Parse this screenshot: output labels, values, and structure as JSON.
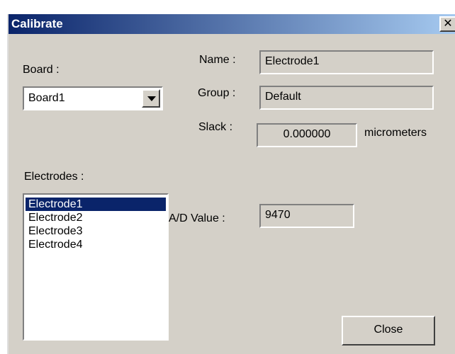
{
  "window": {
    "title": "Calibrate",
    "close_glyph": "✕"
  },
  "board": {
    "label": "Board :",
    "selected": "Board1"
  },
  "name": {
    "label": "Name :",
    "value": "Electrode1"
  },
  "group": {
    "label": "Group :",
    "value": "Default"
  },
  "slack": {
    "label": "Slack :",
    "value": "0.000000",
    "unit": "micrometers"
  },
  "electrodes": {
    "label": "Electrodes :",
    "items": [
      "Electrode1",
      "Electrode2",
      "Electrode3",
      "Electrode4"
    ],
    "selected_index": 0
  },
  "ad_value": {
    "label": "A/D Value :",
    "value": "9470"
  },
  "buttons": {
    "close": "Close"
  },
  "colors": {
    "title_start": "#0a246a",
    "title_end": "#a6caf0",
    "dialog_bg": "#d4d0c8",
    "selection": "#0a246a"
  }
}
